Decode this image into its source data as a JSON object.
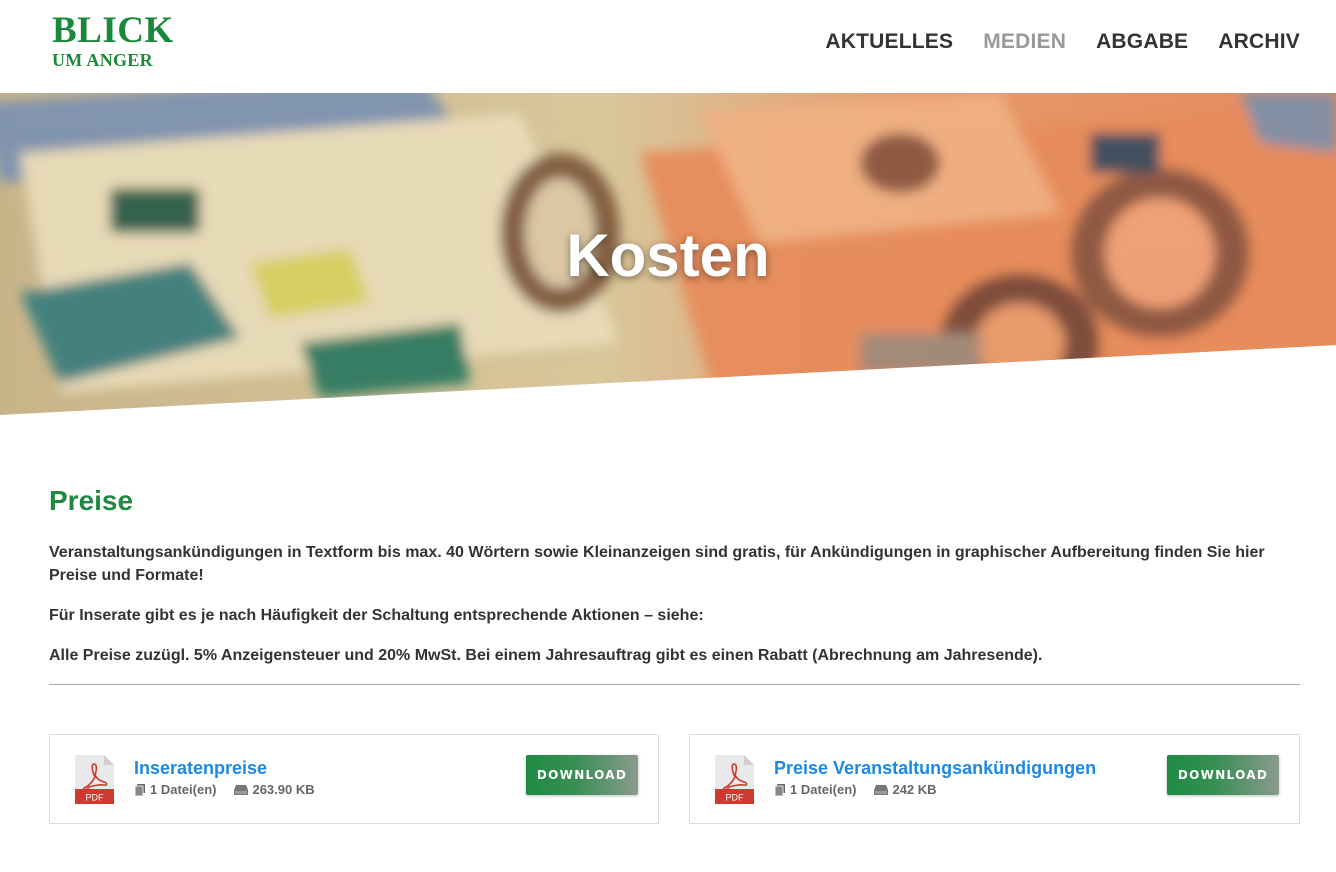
{
  "header": {
    "logo_line1": "BLICK",
    "logo_line2": "UM ANGER",
    "nav": [
      {
        "label": "AKTUELLES"
      },
      {
        "label": "MEDIEN"
      },
      {
        "label": "ABGABE"
      },
      {
        "label": "ARCHIV"
      }
    ]
  },
  "hero": {
    "title": "Kosten"
  },
  "main": {
    "title": "Preise",
    "paragraphs": [
      "Veranstaltungsankündigungen in Textform bis max. 40 Wörtern sowie Kleinanzeigen sind gratis, für Ankündigungen in graphischer Aufbereitung finden Sie hier Preise und Formate!",
      "Für Inserate gibt es je nach Häufigkeit der Schaltung entsprechende Aktionen – siehe:",
      "Alle Preise zuzügl. 5% Anzeigensteuer und 20% MwSt. Bei einem Jahresauftrag gibt es einen Rabatt (Abrechnung am Jahresende)."
    ]
  },
  "downloads": [
    {
      "name": "Inseratenpreise",
      "files": "1 Datei(en)",
      "size": "263.90 KB",
      "button": "DOWNLOAD",
      "icon_label": "PDF"
    },
    {
      "name": "Preise Veranstaltungsankündigungen",
      "files": "1 Datei(en)",
      "size": "242 KB",
      "button": "DOWNLOAD",
      "icon_label": "PDF"
    }
  ],
  "colors": {
    "brand_green": "#1f8a3f",
    "link_blue": "#1e88e5",
    "nav_active": "#999999"
  }
}
